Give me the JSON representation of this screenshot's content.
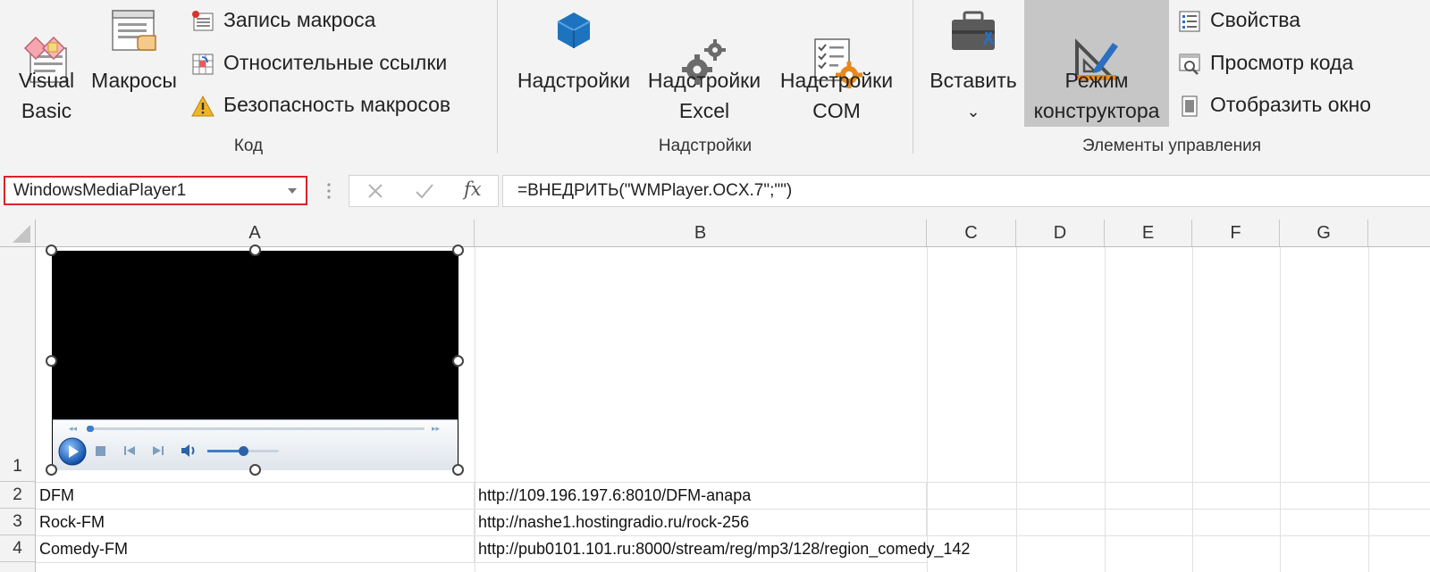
{
  "ribbon": {
    "code_group": {
      "label": "Код",
      "visual_basic": "Visual\nBasic",
      "macros": "Макросы",
      "record_macro": "Запись макроса",
      "relative_refs": "Относительные ссылки",
      "macro_security": "Безопасность макросов"
    },
    "addins_group": {
      "label": "Надстройки",
      "addins": "Надстройки",
      "excel_addins": "Надстройки\nExcel",
      "com_addins": "Надстройки\nCOM"
    },
    "controls_group": {
      "label": "Элементы управления",
      "insert": "Вставить",
      "design_mode": "Режим\nконструктора",
      "properties": "Свойства",
      "view_code": "Просмотр кода",
      "show_window": "Отобразить окно"
    }
  },
  "formula_bar": {
    "name_box": "WindowsMediaPlayer1",
    "formula": "=ВНЕДРИТЬ(\"WMPlayer.OCX.7\";\"\")"
  },
  "columns": [
    "A",
    "B",
    "C",
    "D",
    "E",
    "F",
    "G"
  ],
  "rows": [
    {
      "num": "1",
      "a": "",
      "b": ""
    },
    {
      "num": "2",
      "a": "DFM",
      "b": "http://109.196.197.6:8010/DFM-anapa"
    },
    {
      "num": "3",
      "a": "Rock-FM",
      "b": "http://nashe1.hostingradio.ru/rock-256"
    },
    {
      "num": "4",
      "a": "Comedy-FM",
      "b": "http://pub0101.101.ru:8000/stream/reg/mp3/128/region_comedy_142"
    }
  ],
  "player": {
    "progress": 0.02,
    "volume": 0.5
  },
  "colors": {
    "ribbon_bg": "#f3f3f3",
    "pressed_bg": "#c6c6c6",
    "name_box_border": "#d6242a",
    "accent_blue": "#1e73be",
    "gear_gray": "#6b6b6b",
    "orange": "#e8891c"
  },
  "icons": {
    "visual_basic": "visual-basic-icon",
    "macros": "macros-icon",
    "record_macro": "record-macro-icon",
    "relative_refs": "relative-refs-icon",
    "macro_security": "warning-icon",
    "addins": "store-addins-icon",
    "excel_addins": "gears-icon",
    "com_addins": "com-addins-icon",
    "insert": "toolbox-icon",
    "design_mode": "design-mode-icon",
    "properties": "properties-icon",
    "view_code": "view-code-icon",
    "show_window": "show-window-icon"
  }
}
